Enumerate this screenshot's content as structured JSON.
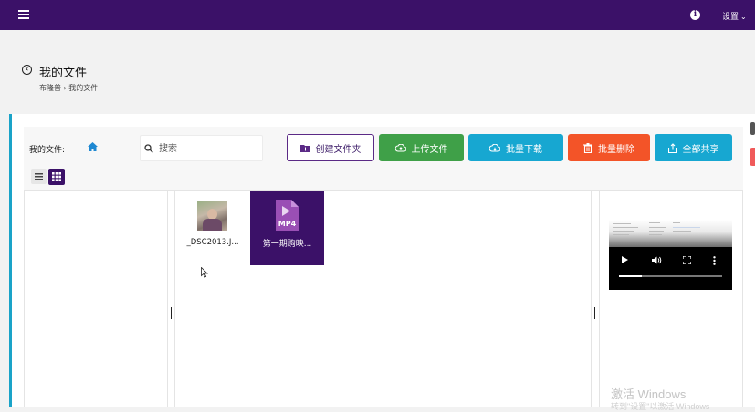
{
  "topbar": {
    "settings_label": "设置"
  },
  "header": {
    "title": "我的文件",
    "breadcrumb": "布隆普 › 我的文件"
  },
  "toolbar": {
    "my_files_label": "我的文件:",
    "search_placeholder": "搜索",
    "buttons": {
      "create_folder": "创建文件夹",
      "upload": "上传文件",
      "batch_download": "批量下载",
      "batch_delete": "批量删除",
      "share_all": "全部共享"
    }
  },
  "files": [
    {
      "name": "_DSC2013.J...",
      "type": "image"
    },
    {
      "name": "第一期购映...",
      "type": "video",
      "badge": "MP4"
    }
  ],
  "player": {
    "progress": 0.22
  },
  "watermark": {
    "title": "激活 Windows",
    "subtitle": "转到\"设置\"以激活 Windows"
  },
  "colors": {
    "topbar": "#3b1168",
    "accent_purple": "#3b1168",
    "upload_green": "#3fa048",
    "info_blue": "#17a7d1",
    "delete_orange": "#f35428",
    "panel_border": "#1aa3c8"
  }
}
